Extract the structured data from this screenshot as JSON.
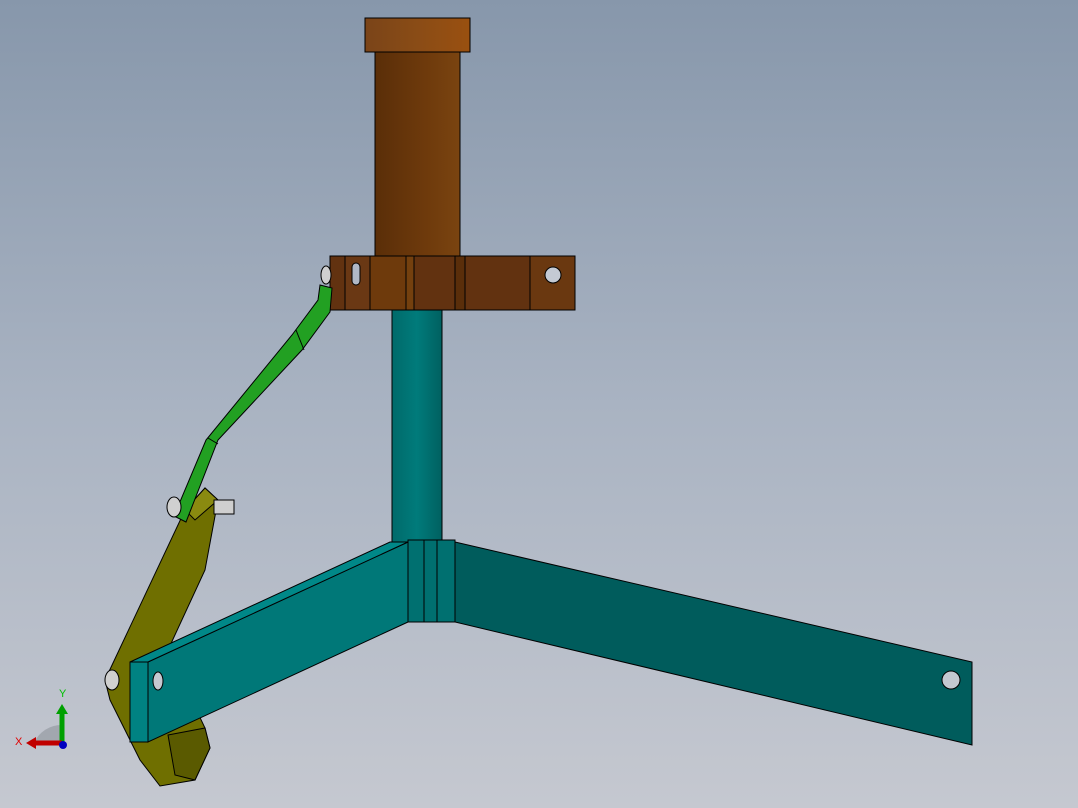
{
  "viewport": {
    "type": "cad-3d-model-view"
  },
  "triad": {
    "x_label": "X",
    "y_label": "Y",
    "x_color": "#c00000",
    "y_color": "#00a000",
    "z_color": "#0000c0"
  },
  "colors": {
    "cylinder": "#6e3a0c",
    "clamp": "#6a3810",
    "post": "#007070",
    "link": "#22a022",
    "lever": "#6e6e00"
  }
}
